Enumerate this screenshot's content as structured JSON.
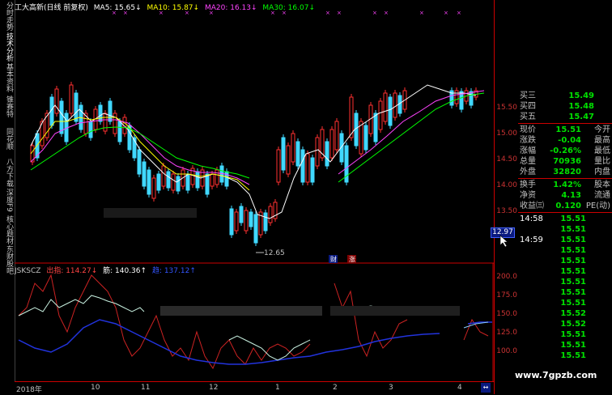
{
  "sidebar": {
    "tabs": [
      {
        "label": "分时走势",
        "active": false
      },
      {
        "label": "技术分析",
        "active": true
      },
      {
        "label": "基本资料",
        "active": false
      },
      {
        "label": "锥赛特",
        "active": false
      },
      {
        "label": "同花顺",
        "active": false
      },
      {
        "label": "八方下载",
        "active": false
      },
      {
        "label": "深度F9",
        "active": false
      },
      {
        "label": "核心题材",
        "active": false
      },
      {
        "label": "东财股吧",
        "active": false
      }
    ]
  },
  "ma_legend": {
    "title": "工大高新(日线 前复权)",
    "ma5": "MA5: 15.65↓",
    "ma10": "MA10: 15.87↓",
    "ma20": "MA20: 16.13↓",
    "ma30": "MA30: 16.07↓",
    "colors": {
      "title": "#ffffff",
      "ma5": "#ffffff",
      "ma10": "#ffff00",
      "ma20": "#ff44ff",
      "ma30": "#00ff00"
    }
  },
  "price_axis": {
    "ticks": [
      "15.50",
      "15.00",
      "14.50",
      "14.00",
      "13.50"
    ],
    "current": "12.97"
  },
  "kline": {
    "low_label": "12.65",
    "marker1": "财",
    "marker2": "涨"
  },
  "quote_panel": {
    "asks": [
      {
        "label": "买三",
        "value": "15.49"
      },
      {
        "label": "买四",
        "value": "15.48"
      },
      {
        "label": "买五",
        "value": "15.47"
      }
    ],
    "stats": [
      {
        "label": "现价",
        "value": "15.51",
        "label2": "今开"
      },
      {
        "label": "涨跌",
        "value": "-0.04",
        "label2": "最高"
      },
      {
        "label": "涨幅",
        "value": "-0.26%",
        "label2": "最低"
      },
      {
        "label": "总量",
        "value": "70936",
        "label2": "量比"
      },
      {
        "label": "外盘",
        "value": "32820",
        "label2": "内盘"
      }
    ],
    "stats2": [
      {
        "label": "换手",
        "value": "1.42%",
        "label2": "股本"
      },
      {
        "label": "净资",
        "value": "4.13",
        "label2": "流通"
      },
      {
        "label": "收益㈢",
        "value": "0.120",
        "label2": "PE(动)"
      }
    ],
    "ticks": [
      {
        "time": "14:58",
        "price": "15.51"
      },
      {
        "time": "",
        "price": "15.51"
      },
      {
        "time": "14:59",
        "price": "15.51"
      },
      {
        "time": "",
        "price": "15.51"
      },
      {
        "time": "",
        "price": "15.51"
      },
      {
        "time": "",
        "price": "15.51"
      },
      {
        "time": "",
        "price": "15.51"
      },
      {
        "time": "",
        "price": "15.51"
      },
      {
        "time": "",
        "price": "15.51"
      },
      {
        "time": "",
        "price": "15.52"
      },
      {
        "time": "",
        "price": "15.52"
      },
      {
        "time": "",
        "price": "15.51"
      },
      {
        "time": "",
        "price": "15.51"
      },
      {
        "time": "",
        "price": "15.51"
      }
    ]
  },
  "indicator": {
    "name": "JSKSCZ",
    "out_label": "出指: 114.27↓",
    "mid_label": "筋: 140.36↑",
    "blue_label": "趋: 137.12↑",
    "ticks": [
      "200.0",
      "175.0",
      "150.0",
      "125.0",
      "100.0"
    ]
  },
  "date_axis": {
    "labels": [
      "2018年",
      "10",
      "11",
      "12",
      "1",
      "2",
      "3",
      "4"
    ]
  },
  "watermark": "www.7gpzb.com"
}
